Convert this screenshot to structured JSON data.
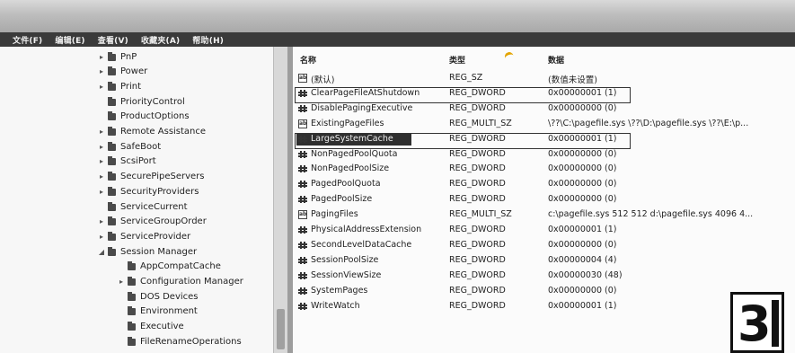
{
  "menubar": [
    "文件(F)",
    "编辑(E)",
    "查看(V)",
    "收藏夹(A)",
    "帮助(H)"
  ],
  "tree": [
    {
      "label": "PnP",
      "expander": "▸"
    },
    {
      "label": "Power",
      "expander": "▸"
    },
    {
      "label": "Print",
      "expander": "▸"
    },
    {
      "label": "PriorityControl",
      "expander": ""
    },
    {
      "label": "ProductOptions",
      "expander": ""
    },
    {
      "label": "Remote Assistance",
      "expander": "▸"
    },
    {
      "label": "SafeBoot",
      "expander": "▸"
    },
    {
      "label": "ScsiPort",
      "expander": "▸"
    },
    {
      "label": "SecurePipeServers",
      "expander": "▸"
    },
    {
      "label": "SecurityProviders",
      "expander": "▸"
    },
    {
      "label": "ServiceCurrent",
      "expander": ""
    },
    {
      "label": "ServiceGroupOrder",
      "expander": "▸"
    },
    {
      "label": "ServiceProvider",
      "expander": "▸"
    },
    {
      "label": "Session Manager",
      "expander": "◢"
    },
    {
      "label": "AppCompatCache",
      "expander": "",
      "child": true
    },
    {
      "label": "Configuration Manager",
      "expander": "▸",
      "child": true
    },
    {
      "label": "DOS Devices",
      "expander": "",
      "child": true
    },
    {
      "label": "Environment",
      "expander": "",
      "child": true
    },
    {
      "label": "Executive",
      "expander": "",
      "child": true
    },
    {
      "label": "FileRenameOperations",
      "expander": "",
      "child": true
    }
  ],
  "columns": {
    "name": "名称",
    "type": "类型",
    "data": "数据"
  },
  "values": [
    {
      "name": "(默认)",
      "type": "REG_SZ",
      "data": "(数值未设置)",
      "icon": "sz"
    },
    {
      "name": "ClearPageFileAtShutdown",
      "type": "REG_DWORD",
      "data": "0x00000001 (1)",
      "icon": "dw"
    },
    {
      "name": "DisablePagingExecutive",
      "type": "REG_DWORD",
      "data": "0x00000000 (0)",
      "icon": "dw"
    },
    {
      "name": "ExistingPageFiles",
      "type": "REG_MULTI_SZ",
      "data": "\\??\\C:\\pagefile.sys \\??\\D:\\pagefile.sys \\??\\E:\\p...",
      "icon": "sz"
    },
    {
      "name": "LargeSystemCache",
      "type": "REG_DWORD",
      "data": "0x00000001 (1)",
      "icon": "dw"
    },
    {
      "name": "NonPagedPoolQuota",
      "type": "REG_DWORD",
      "data": "0x00000000 (0)",
      "icon": "dw"
    },
    {
      "name": "NonPagedPoolSize",
      "type": "REG_DWORD",
      "data": "0x00000000 (0)",
      "icon": "dw"
    },
    {
      "name": "PagedPoolQuota",
      "type": "REG_DWORD",
      "data": "0x00000000 (0)",
      "icon": "dw"
    },
    {
      "name": "PagedPoolSize",
      "type": "REG_DWORD",
      "data": "0x00000000 (0)",
      "icon": "dw"
    },
    {
      "name": "PagingFiles",
      "type": "REG_MULTI_SZ",
      "data": "c:\\pagefile.sys 512 512 d:\\pagefile.sys 4096 4...",
      "icon": "sz"
    },
    {
      "name": "PhysicalAddressExtension",
      "type": "REG_DWORD",
      "data": "0x00000001 (1)",
      "icon": "dw"
    },
    {
      "name": "SecondLevelDataCache",
      "type": "REG_DWORD",
      "data": "0x00000000 (0)",
      "icon": "dw"
    },
    {
      "name": "SessionPoolSize",
      "type": "REG_DWORD",
      "data": "0x00000004 (4)",
      "icon": "dw"
    },
    {
      "name": "SessionViewSize",
      "type": "REG_DWORD",
      "data": "0x00000030 (48)",
      "icon": "dw"
    },
    {
      "name": "SystemPages",
      "type": "REG_DWORD",
      "data": "0x00000000 (0)",
      "icon": "dw"
    },
    {
      "name": "WriteWatch",
      "type": "REG_DWORD",
      "data": "0x00000001 (1)",
      "icon": "dw"
    }
  ],
  "badge": {
    "number": "3"
  },
  "colors": {
    "menubar": "#3a3a3a",
    "selection": "#2f2f2f"
  }
}
